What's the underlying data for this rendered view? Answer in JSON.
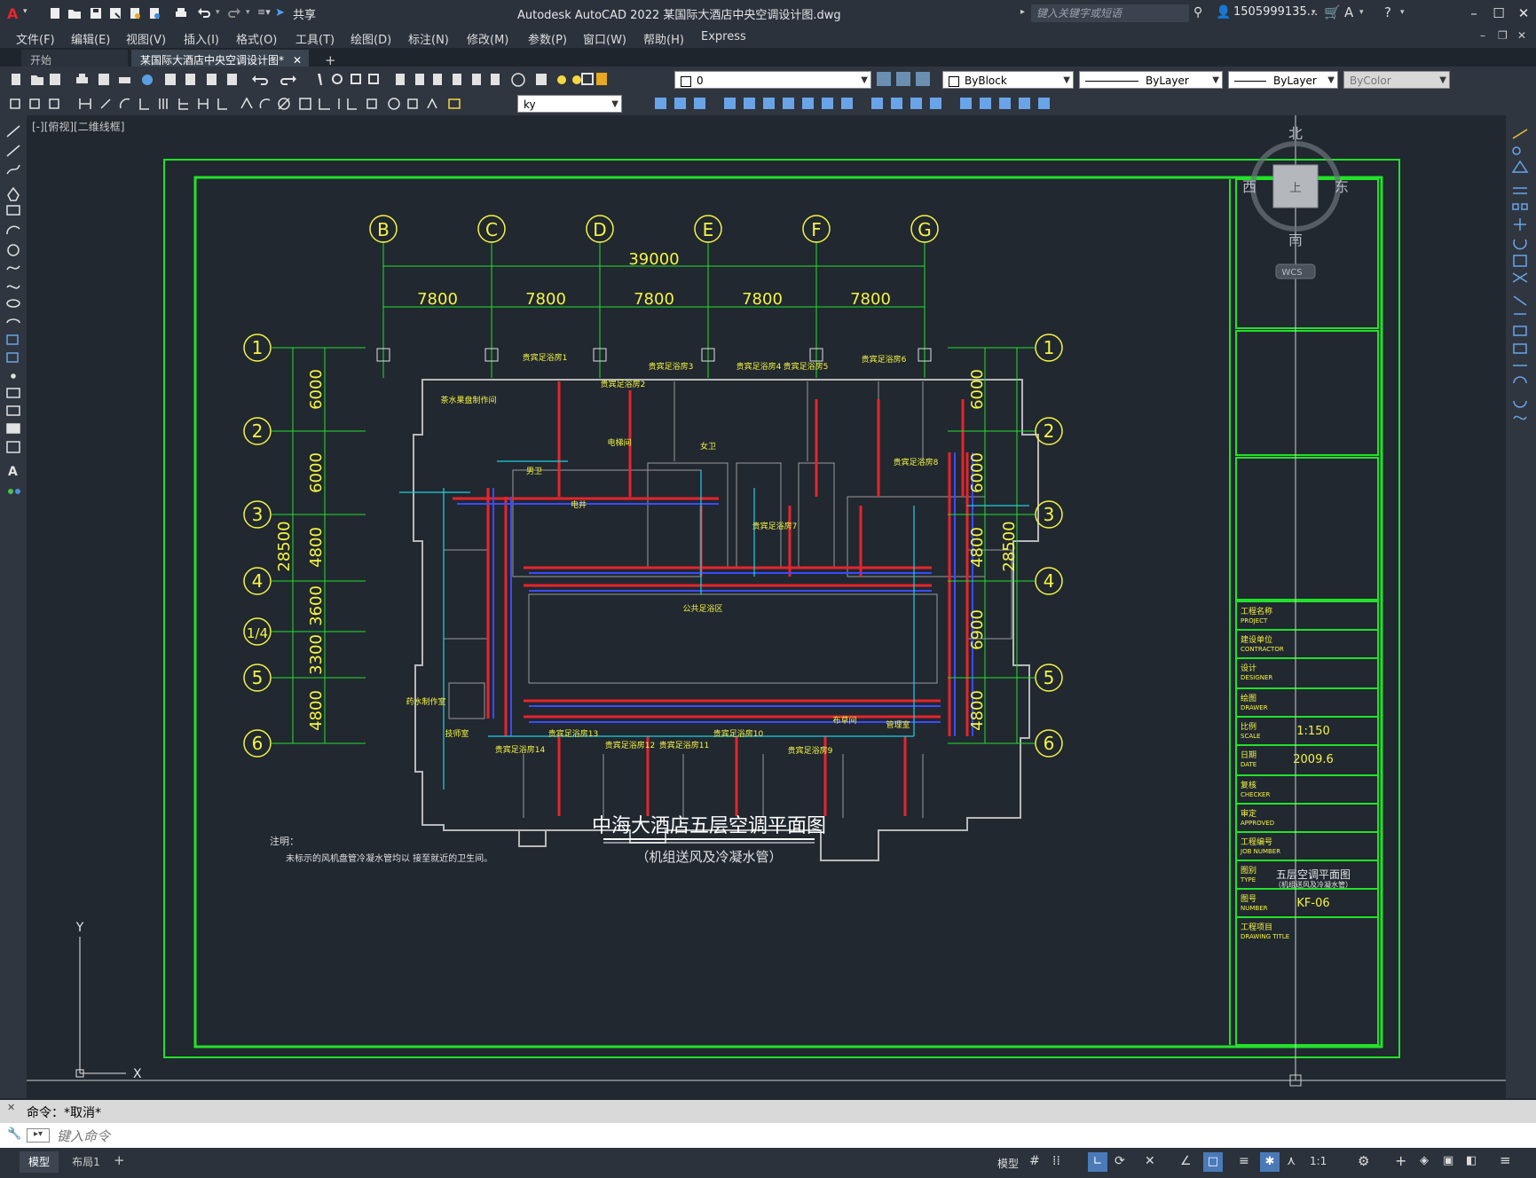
{
  "app": {
    "title": "Autodesk AutoCAD 2022    某国际大酒店中央空调设计图.dwg",
    "share_label": "共享",
    "search_placeholder": "键入关键字或短语",
    "user": "1505999135...",
    "accent": "#e8242b"
  },
  "menu": [
    "文件(F)",
    "编辑(E)",
    "视图(V)",
    "插入(I)",
    "格式(O)",
    "工具(T)",
    "绘图(D)",
    "标注(N)",
    "修改(M)",
    "参数(P)",
    "窗口(W)",
    "帮助(H)",
    "Express"
  ],
  "tabs": [
    {
      "label": "开始",
      "active": false
    },
    {
      "label": "某国际大酒店中央空调设计图*",
      "active": true
    }
  ],
  "toolbar": {
    "layer": "0",
    "color": "ByBlock",
    "linetype": "ByLayer",
    "lineweight": "ByLayer",
    "plotstyle": "ByColor",
    "dimstyle": "ky"
  },
  "viewport_label": "[-][俯视][二维线框]",
  "viewcube": {
    "north": "北",
    "south": "南",
    "east": "东",
    "west": "西",
    "top": "上",
    "wcs": "WCS"
  },
  "drawing": {
    "col_grid": [
      "B",
      "C",
      "D",
      "E",
      "F",
      "G"
    ],
    "row_grid": [
      "1",
      "2",
      "3",
      "4",
      "1/4",
      "5",
      "6"
    ],
    "overall_width": "39000",
    "bay_widths": [
      "7800",
      "7800",
      "7800",
      "7800",
      "7800"
    ],
    "left_dims": [
      "6000",
      "6000",
      "4800",
      "3600",
      "3300",
      "4800"
    ],
    "right_dims": [
      "6000",
      "6000",
      "4800",
      "6900",
      "4800"
    ],
    "overall_height": "28500",
    "rooms": [
      "贵宾足浴房1",
      "贵宾足浴房2",
      "贵宾足浴房3",
      "贵宾足浴房4",
      "贵宾足浴房5",
      "贵宾足浴房6",
      "贵宾足浴房7",
      "贵宾足浴房8",
      "贵宾足浴房9",
      "贵宾足浴房10",
      "贵宾足浴房11",
      "贵宾足浴房12",
      "贵宾足浴房13",
      "贵宾足浴房14",
      "茶水果盘制作间",
      "电梯间",
      "电井",
      "男卫",
      "女卫",
      "公共足浴区",
      "药水制作室",
      "技师室",
      "布草间",
      "管理室"
    ],
    "title_main": "中海大酒店五层空调平面图",
    "title_sub": "（机组送风及冷凝水管）",
    "notes_label": "注明：",
    "notes_text": "未标示的风机盘管冷凝水管均以  接至就近的卫生间。"
  },
  "titleblock": [
    {
      "label": "工程名称",
      "en": "PROJECT",
      "value": ""
    },
    {
      "label": "建设单位",
      "en": "CONTRACTOR",
      "value": ""
    },
    {
      "label": "设计",
      "en": "DESIGNER",
      "value": ""
    },
    {
      "label": "绘图",
      "en": "DRAWER",
      "value": ""
    },
    {
      "label": "比例",
      "en": "SCALE",
      "value": "1:150"
    },
    {
      "label": "日期",
      "en": "DATE",
      "value": "2009.6"
    },
    {
      "label": "复核",
      "en": "CHECKER",
      "value": ""
    },
    {
      "label": "审定",
      "en": "APPROVED",
      "value": ""
    },
    {
      "label": "工程编号",
      "en": "JOB NUMBER",
      "value": ""
    },
    {
      "label": "图别",
      "en": "TYPE",
      "value": "五层空调平面图"
    },
    {
      "label": "图号",
      "en": "NUMBER",
      "value": "KF-06"
    },
    {
      "label": "工程项目",
      "en": "DRAWING TITLE",
      "value": ""
    }
  ],
  "titleblock_type_sub": "（机组送风及冷凝水管）",
  "command": {
    "history": "命令：*取消*",
    "placeholder": "键入命令"
  },
  "status": {
    "tabs": [
      "模型",
      "布局1"
    ],
    "model_label": "模型",
    "scale": "1:1"
  }
}
